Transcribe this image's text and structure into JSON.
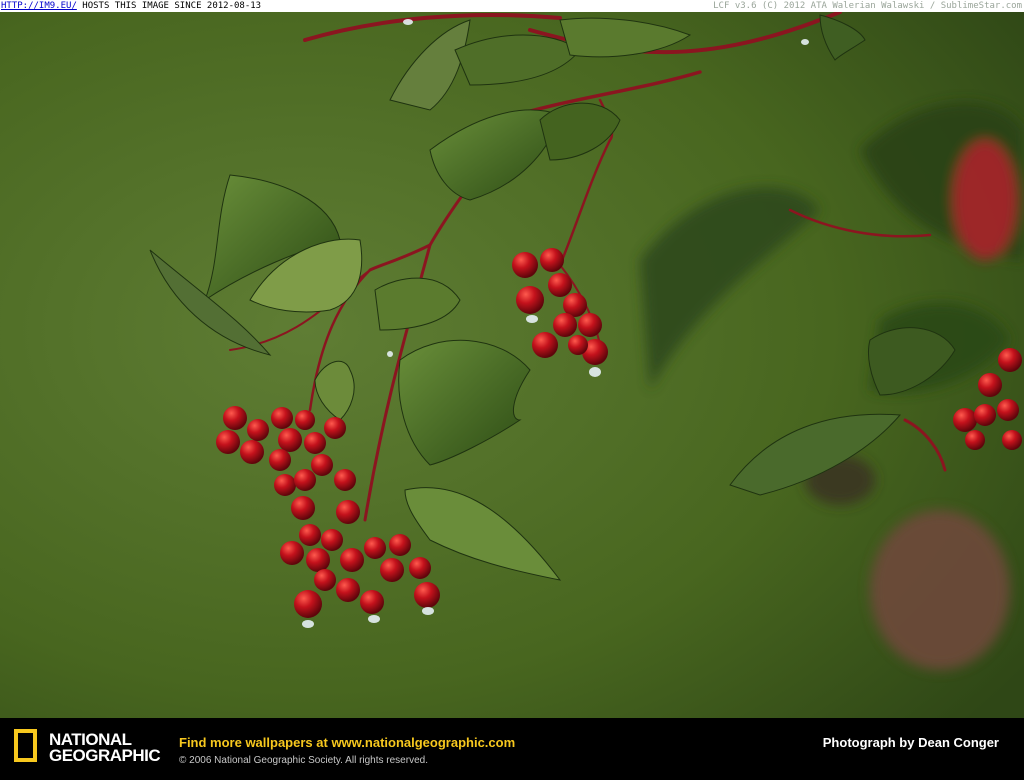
{
  "watermark": {
    "link": "HTTP://IM9.EU/",
    "hosts": " HOSTS THIS IMAGE SINCE 2012-08-13",
    "credit": "LCF v3.6 (C) 2012 ATA Walerian Walawski / SublimeStar.com"
  },
  "footer": {
    "logo_line1": "NATIONAL",
    "logo_line2": "GEOGRAPHIC",
    "promo_prefix": "Find more wallpapers at ",
    "promo_url": "www.nationalgeographic.com",
    "copyright": "© 2006 National Geographic Society. All rights reserved.",
    "photographer": "Photograph by Dean Conger"
  },
  "colors": {
    "background_green": "#4f6d2a",
    "leaf": "#3e6b24",
    "berry": "#c4121c",
    "stem": "#8b1520",
    "logo_yellow": "#f7c81e"
  }
}
